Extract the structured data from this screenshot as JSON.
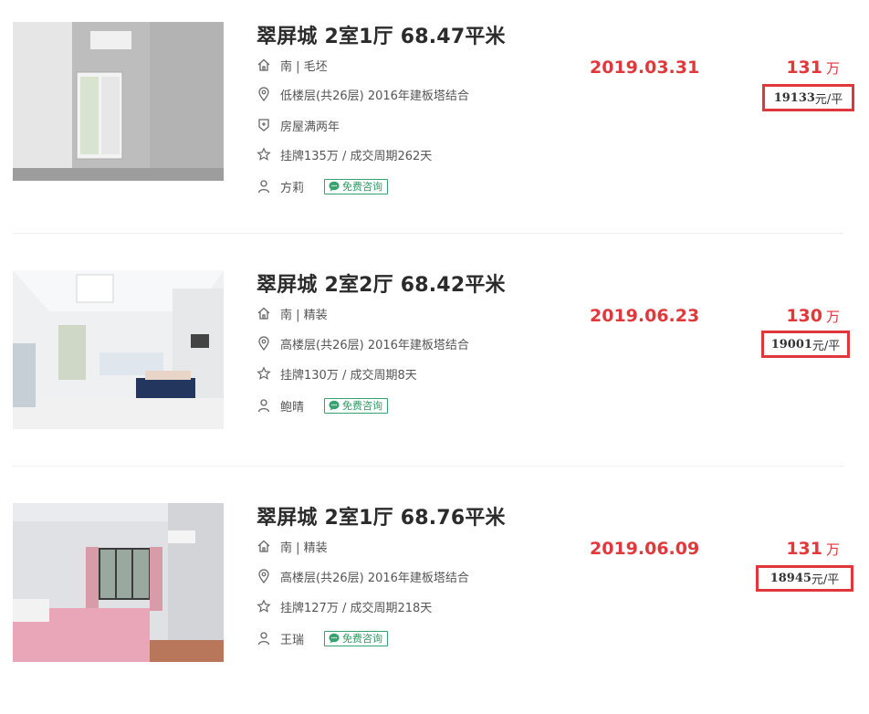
{
  "listings": [
    {
      "title": "翠屏城 2室1厅 68.47平米",
      "orientation_decoration": "南 | 毛坯",
      "floor_info": "低楼层(共26层) 2016年建板塔结合",
      "tag": "房屋满两年",
      "listing_cycle": "挂牌135万 / 成交周期262天",
      "agent": "方莉",
      "consult_label": "免费咨询",
      "deal_date": "2019.03.31",
      "total_price": "131",
      "total_unit": "万",
      "unit_price_value": "19133",
      "unit_price_suffix": "元/平"
    },
    {
      "title": "翠屏城 2室2厅 68.42平米",
      "orientation_decoration": "南 | 精装",
      "floor_info": "高楼层(共26层) 2016年建板塔结合",
      "listing_cycle": "挂牌130万 / 成交周期8天",
      "agent": "鲍晴",
      "consult_label": "免费咨询",
      "deal_date": "2019.06.23",
      "total_price": "130",
      "total_unit": "万",
      "unit_price_value": "19001",
      "unit_price_suffix": "元/平"
    },
    {
      "title": "翠屏城 2室1厅 68.76平米",
      "orientation_decoration": "南 | 精装",
      "floor_info": "高楼层(共26层) 2016年建板塔结合",
      "listing_cycle": "挂牌127万 / 成交周期218天",
      "agent": "王瑞",
      "consult_label": "免费咨询",
      "deal_date": "2019.06.09",
      "total_price": "131",
      "total_unit": "万",
      "unit_price_value": "18945",
      "unit_price_suffix": "元/平"
    }
  ],
  "colors": {
    "price_red": "#e1383b",
    "highlight_box": "#e0373d",
    "consult_green": "#35a36d"
  },
  "icons": {
    "orientation": "house-icon",
    "floor": "location-pin-icon",
    "tag": "shield-icon",
    "listing": "star-icon",
    "agent": "person-icon",
    "consult": "chat-bubble-icon"
  }
}
